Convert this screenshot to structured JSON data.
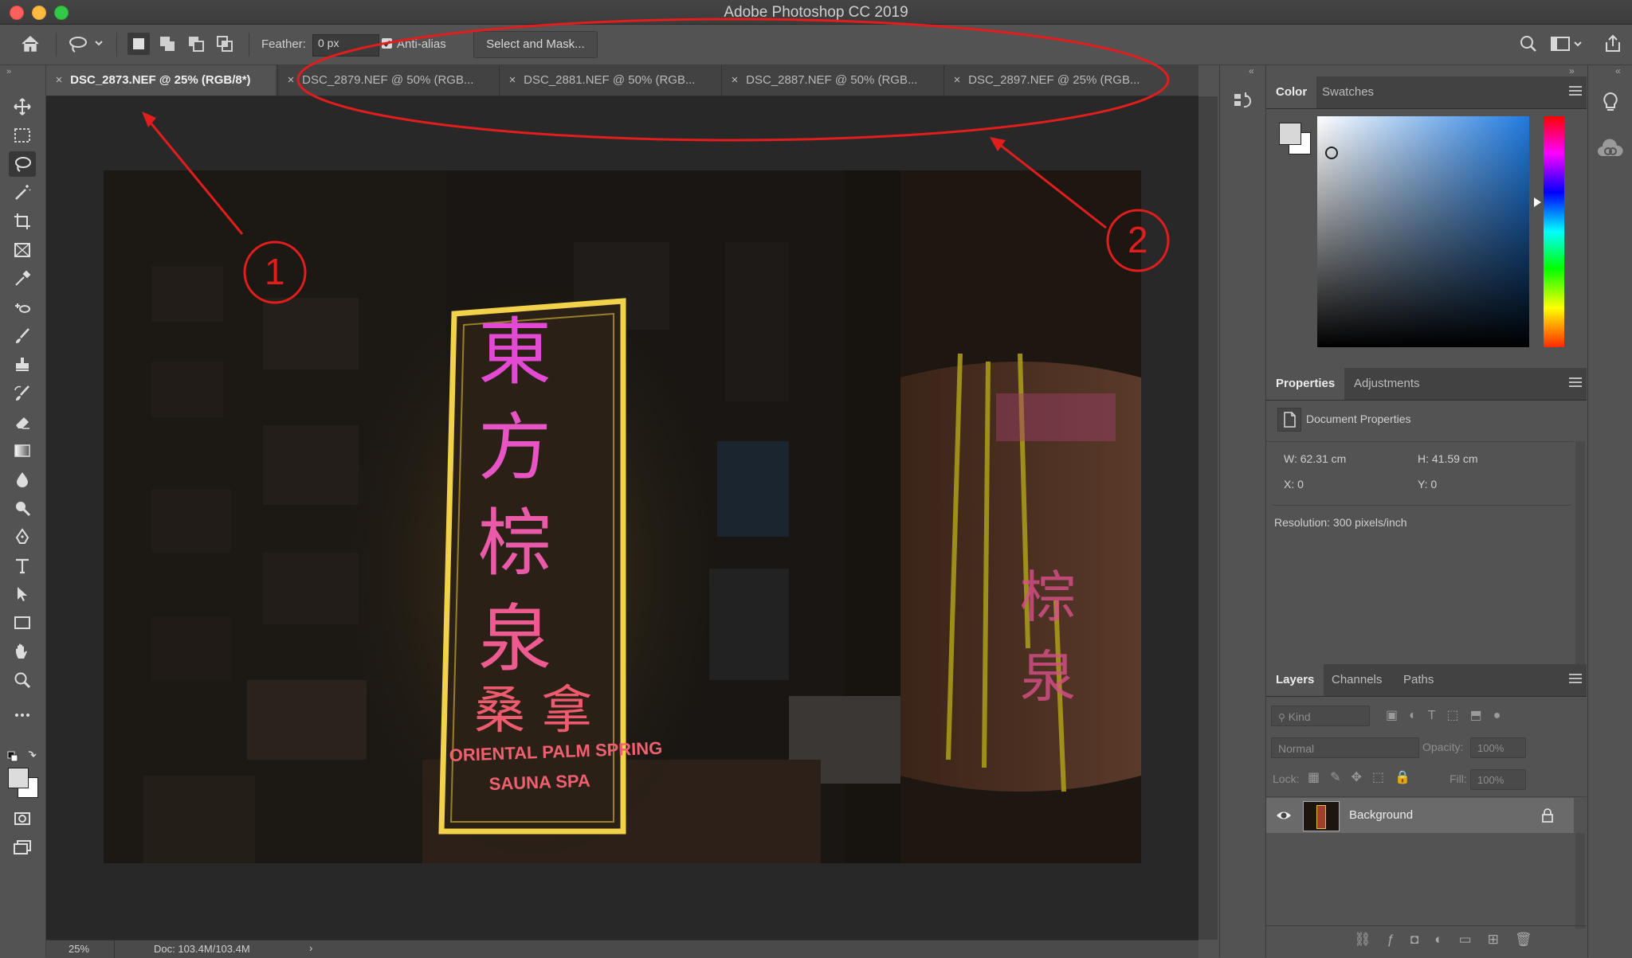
{
  "app": {
    "title": "Adobe Photoshop CC 2019"
  },
  "options_bar": {
    "feather_label": "Feather:",
    "feather_value": "0 px",
    "anti_alias_label": "Anti-alias",
    "select_and_mask_label": "Select and Mask..."
  },
  "tabs": [
    {
      "label": "DSC_2873.NEF @ 25% (RGB/8*)",
      "active": true
    },
    {
      "label": "DSC_2879.NEF @ 50% (RGB...",
      "active": false
    },
    {
      "label": "DSC_2881.NEF @ 50% (RGB...",
      "active": false
    },
    {
      "label": "DSC_2887.NEF @ 50% (RGB...",
      "active": false
    },
    {
      "label": "DSC_2897.NEF @ 25% (RGB...",
      "active": false
    }
  ],
  "status": {
    "zoom": "25%",
    "doc": "Doc: 103.4M/103.4M"
  },
  "color_panel": {
    "tabs": [
      "Color",
      "Swatches"
    ]
  },
  "properties_panel": {
    "tabs": [
      "Properties",
      "Adjustments"
    ],
    "heading": "Document Properties",
    "w": "W:  62.31 cm",
    "h": "H:  41.59 cm",
    "x": "X:  0",
    "y": "Y:  0",
    "resolution": "Resolution: 300 pixels/inch"
  },
  "layers_panel": {
    "tabs": [
      "Layers",
      "Channels",
      "Paths"
    ],
    "kind": "Kind",
    "blend_mode": "Normal",
    "opacity_label": "Opacity:",
    "opacity_value": "100%",
    "lock_label": "Lock:",
    "fill_label": "Fill:",
    "fill_value": "100%",
    "layer_name": "Background"
  },
  "photo": {
    "sign_chars": [
      "東",
      "方",
      "棕",
      "泉"
    ],
    "sign_sub": "桑 拿",
    "sign_en1": "ORIENTAL PALM SPRING",
    "sign_en2": "SAUNA SPA",
    "right_sign_chars": [
      "棕",
      "泉"
    ]
  },
  "annotations": {
    "label_1": "1",
    "label_2": "2"
  },
  "colors": {
    "accent_red": "#e11d1d",
    "ui_bg": "#535353",
    "canvas_bg": "#282828"
  }
}
